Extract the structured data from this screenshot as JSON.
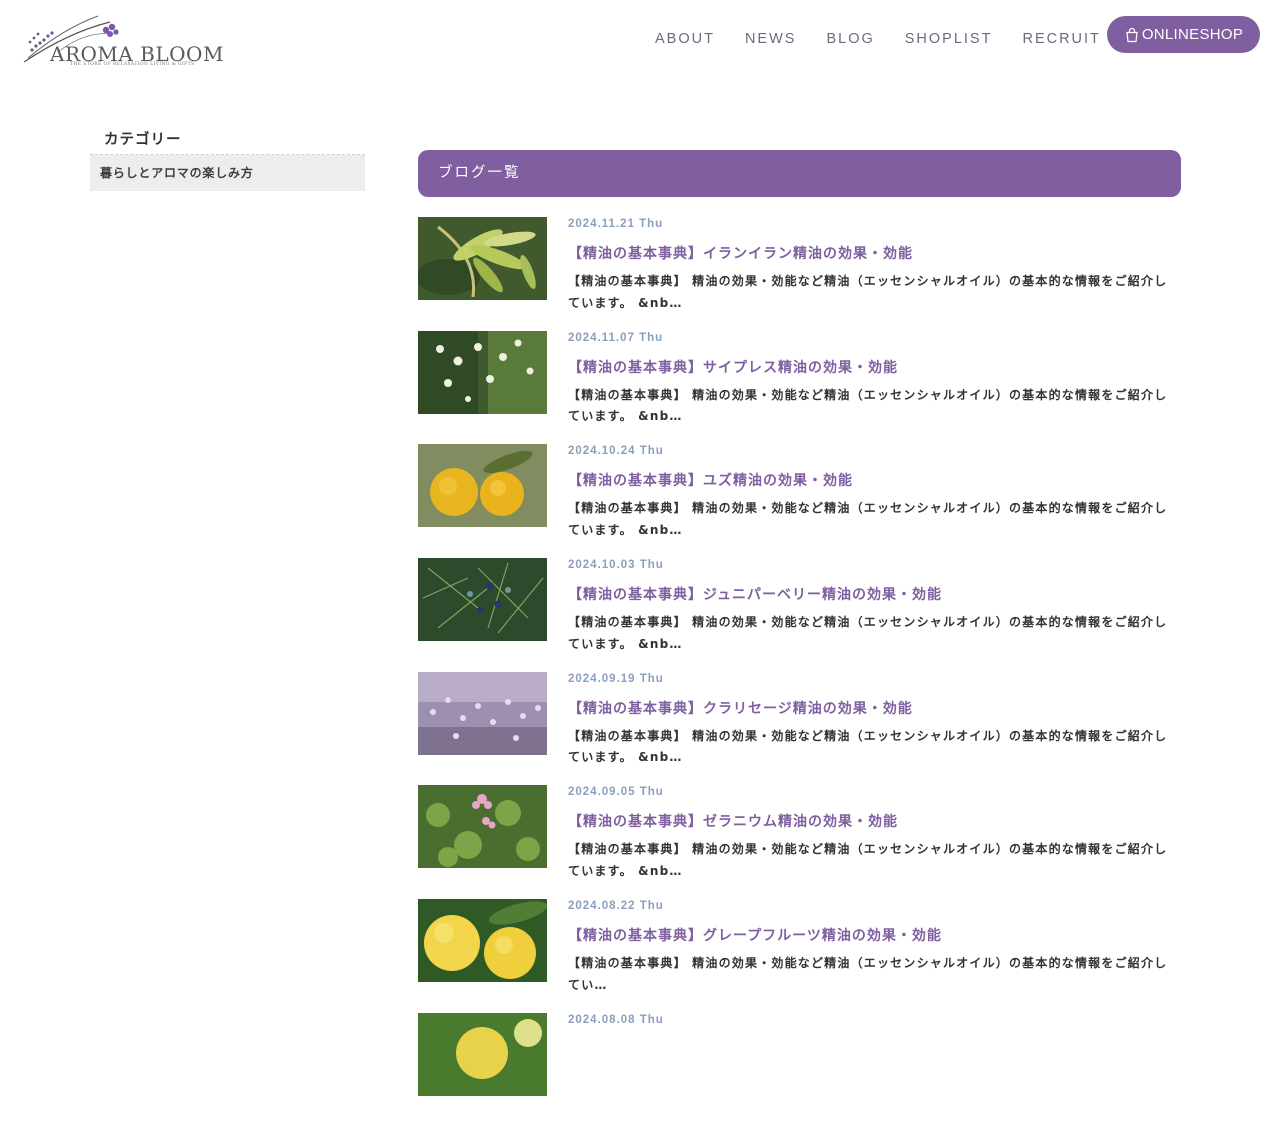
{
  "header": {
    "logo_text": "AROMA BLOOM",
    "logo_sub": "THE STORE OF RELAXATION LIVING & GIFTS",
    "nav": [
      "ABOUT",
      "NEWS",
      "BLOG",
      "SHOPLIST",
      "RECRUIT"
    ],
    "shop_button": "ONLINESHOP",
    "accent_color": "#7f5fa0"
  },
  "sidebar": {
    "title": "カテゴリー",
    "items": [
      {
        "label": "暮らしとアロマの楽しみ方"
      }
    ]
  },
  "main": {
    "heading": "ブログ一覧",
    "posts": [
      {
        "date": "2024.11.21 Thu",
        "title": "【精油の基本事典】イランイラン精油の効果・効能",
        "excerpt": "【精油の基本事典】 精油の効果・効能など精油（エッセンシャルオイル）の基本的な情報をご紹介しています。 &nb…",
        "image": "ylang-ylang-leaves"
      },
      {
        "date": "2024.11.07 Thu",
        "title": "【精油の基本事典】サイプレス精油の効果・効能",
        "excerpt": "【精油の基本事典】 精油の効果・効能など精油（エッセンシャルオイル）の基本的な情報をご紹介しています。 &nb…",
        "image": "cypress-branches"
      },
      {
        "date": "2024.10.24 Thu",
        "title": "【精油の基本事典】ユズ精油の効果・効能",
        "excerpt": "【精油の基本事典】 精油の効果・効能など精油（エッセンシャルオイル）の基本的な情報をご紹介しています。 &nb…",
        "image": "yuzu-fruits"
      },
      {
        "date": "2024.10.03 Thu",
        "title": "【精油の基本事典】ジュニパーベリー精油の効果・効能",
        "excerpt": "【精油の基本事典】 精油の効果・効能など精油（エッセンシャルオイル）の基本的な情報をご紹介しています。 &nb…",
        "image": "juniper-berries"
      },
      {
        "date": "2024.09.19 Thu",
        "title": "【精油の基本事典】クラリセージ精油の効果・効能",
        "excerpt": "【精油の基本事典】 精油の効果・効能など精油（エッセンシャルオイル）の基本的な情報をご紹介しています。 &nb…",
        "image": "clary-sage-flowers"
      },
      {
        "date": "2024.09.05 Thu",
        "title": "【精油の基本事典】ゼラニウム精油の効果・効能",
        "excerpt": "【精油の基本事典】 精油の効果・効能など精油（エッセンシャルオイル）の基本的な情報をご紹介しています。 &nb…",
        "image": "geranium-plant"
      },
      {
        "date": "2024.08.22 Thu",
        "title": "【精油の基本事典】グレープフルーツ精油の効果・効能",
        "excerpt": " 【精油の基本事典】 精油の効果・効能など精油（エッセンシャルオイル）の基本的な情報をご紹介してい…",
        "image": "grapefruit-fruits"
      },
      {
        "date": "2024.08.08 Thu",
        "title": "",
        "excerpt": "",
        "image": "citrus-fruit"
      }
    ]
  }
}
